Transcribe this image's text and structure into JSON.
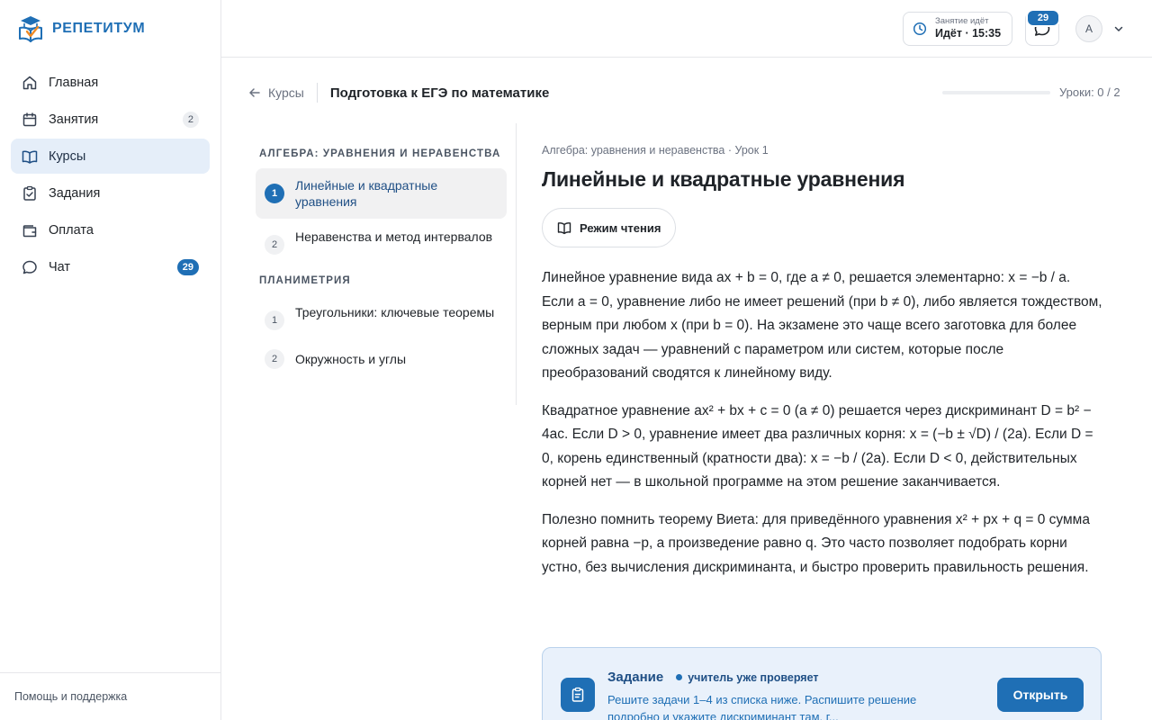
{
  "brand": {
    "name": "РЕПЕТИТУМ",
    "logo_icon": "book-education-logo"
  },
  "sidebar": {
    "items": [
      {
        "label": "Главная",
        "icon": "home-icon",
        "badge": null
      },
      {
        "label": "Занятия",
        "icon": "calendar-icon",
        "badge": "2"
      },
      {
        "label": "Курсы",
        "icon": "open-book-icon",
        "badge": null,
        "active": true
      },
      {
        "label": "Задания",
        "icon": "clipboard-check-icon",
        "badge": null
      },
      {
        "label": "Оплата",
        "icon": "wallet-icon",
        "badge": null
      },
      {
        "label": "Чат",
        "icon": "chat-bubble-icon",
        "badge": "29"
      }
    ],
    "footer_label": "Помощь и поддержка"
  },
  "topbar": {
    "session_caption": "Занятие идёт",
    "session_value": "Идёт · 15:35",
    "chat_badge": "29",
    "avatar_initial": "A"
  },
  "header": {
    "back_label": "Курсы",
    "course_title": "Подготовка к ЕГЭ по математике",
    "progress_label": "Уроки: 0 / 2",
    "progress_fraction": 0
  },
  "lessons": {
    "sections": [
      {
        "title": "АЛГЕБРА: УРАВНЕНИЯ И НЕРАВЕНСТВА",
        "items": [
          {
            "num": "1",
            "label": "Линейные и квадратные уравнения",
            "active": true
          },
          {
            "num": "2",
            "label": "Неравенства и метод интервалов",
            "active": false
          }
        ]
      },
      {
        "title": "ПЛАНИМЕТРИЯ",
        "items": [
          {
            "num": "1",
            "label": "Треугольники: ключевые теоремы",
            "active": false
          },
          {
            "num": "2",
            "label": "Окружность и углы",
            "active": false
          }
        ]
      }
    ]
  },
  "content": {
    "meta": "Алгебра: уравнения и неравенства · Урок 1",
    "title": "Линейные и квадратные уравнения",
    "reading_mode_label": "Режим чтения",
    "paragraphs": [
      "Линейное уравнение вида ax + b = 0, где a ≠ 0, решается элементарно: x = −b / a. Если a = 0, уравнение либо не имеет решений (при b ≠ 0), либо является тождеством, верным при любом x (при b = 0). На экзамене это чаще всего заготовка для более сложных задач — уравнений с параметром или систем, которые после преобразований сводятся к линейному виду.",
      "Квадратное уравнение ax² + bx + c = 0 (a ≠ 0) решается через дискриминант D = b² − 4ac. Если D > 0, уравнение имеет два различных корня: x = (−b ± √D) / (2a). Если D = 0, корень единственный (кратности два): x = −b / (2a). Если D < 0, действительных корней нет — в школьной программе на этом решение заканчивается.",
      "Полезно помнить теорему Виета: для приведённого уравнения x² + px + q = 0 сумма корней равна −p, а произведение равно q. Это часто позволяет подобрать корни устно, без вычисления дискриминанта, и быстро проверить правильность решения."
    ]
  },
  "task": {
    "title": "Задание",
    "status": "учитель уже проверяет",
    "description": "Решите задачи 1–4 из списка ниже. Распишите решение подробно и укажите дискриминант там, г...",
    "open_label": "Открыть"
  },
  "colors": {
    "accent": "#1f6fb5",
    "active_nav_bg": "#e5eef9",
    "task_bg": "#e9f1fb"
  }
}
